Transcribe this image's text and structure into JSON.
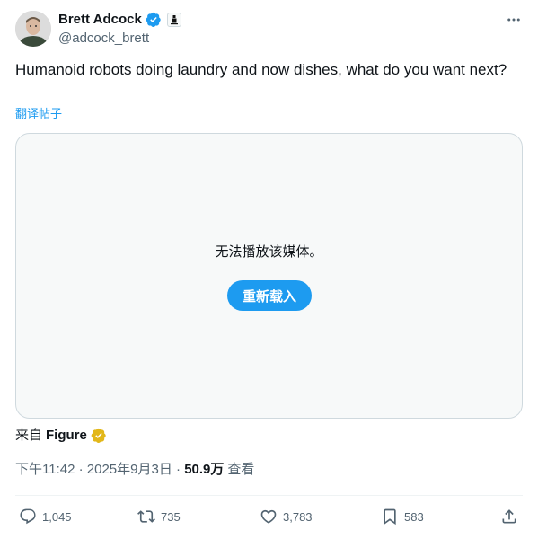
{
  "author": {
    "name": "Brett Adcock",
    "handle": "@adcock_brett"
  },
  "more_icon": "ellipsis-icon",
  "tweet": {
    "text": "Humanoid robots doing laundry and now dishes, what do you want next?",
    "translate_label": "翻译帖子"
  },
  "media": {
    "error_text": "无法播放该媒体。",
    "reload_label": "重新载入"
  },
  "source": {
    "prefix": "来自",
    "name": "Figure"
  },
  "meta": {
    "time": "下午11:42",
    "separator": " · ",
    "date": "2025年9月3日",
    "separator2": " · ",
    "views": "50.9万",
    "views_label": "查看"
  },
  "actions": {
    "replies": "1,045",
    "retweets": "735",
    "likes": "3,783",
    "bookmarks": "583"
  },
  "colors": {
    "accent": "#1d9bf0",
    "text": "#0f1419",
    "muted": "#536471",
    "gold": "#e2b719"
  }
}
